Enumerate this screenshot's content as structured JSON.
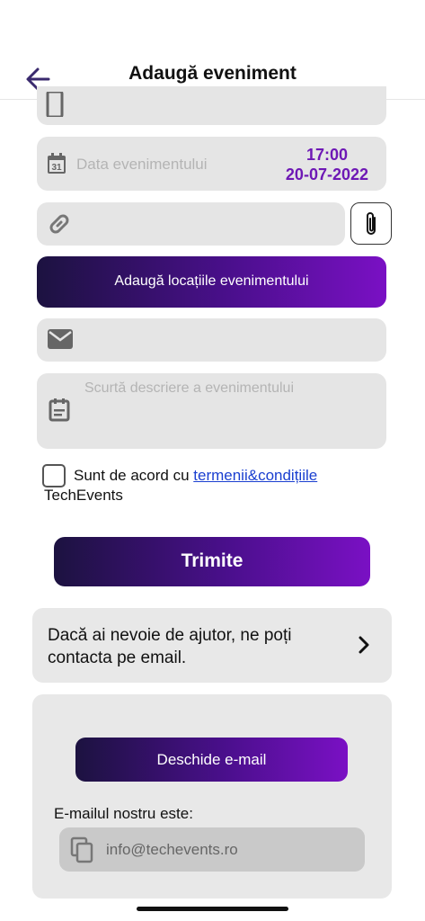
{
  "header": {
    "title": "Adaugă eveniment"
  },
  "form": {
    "date_placeholder": "Data evenimentului",
    "time_value": "17:00",
    "date_value": "20-07-2022",
    "date_icon_day": "31",
    "add_locations_label": "Adaugă locațiile evenimentului",
    "description_placeholder": "Scurtă descriere a evenimentului",
    "terms_prefix": "Sunt de acord cu ",
    "terms_link": "termenii&condițiile",
    "terms_suffix": "TechEvents",
    "submit_label": "Trimite"
  },
  "help": {
    "text": "Dacă ai nevoie de ajutor, ne poți contacta pe email.",
    "open_email_label": "Deschide e-mail",
    "email_caption": "E-mailul nostru este:",
    "email_value": "info@techevents.ro"
  },
  "icons": [
    "back-arrow-icon",
    "phone-icon",
    "calendar-icon",
    "link-icon",
    "paperclip-icon",
    "email-icon",
    "notes-icon",
    "chevron-right-icon",
    "copy-icon"
  ],
  "colors": {
    "accent": "#6e18b5",
    "gradient_start": "#1c1240",
    "gradient_end": "#7a10c4",
    "field_bg": "#e5e5e5"
  }
}
